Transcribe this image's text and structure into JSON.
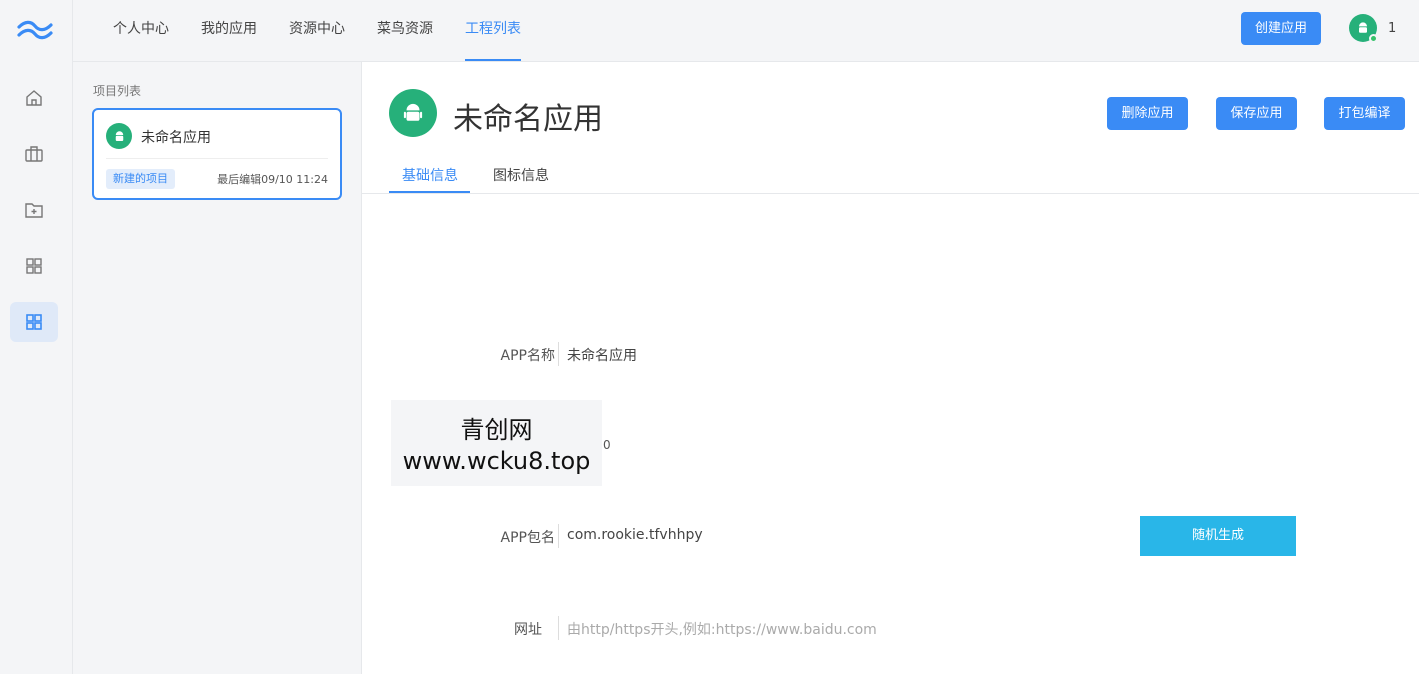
{
  "colors": {
    "accent": "#3a8bf5",
    "android": "#26b07a",
    "generate": "#29b6e8"
  },
  "topnav": {
    "items": [
      "个人中心",
      "我的应用",
      "资源中心",
      "菜鸟资源",
      "工程列表"
    ],
    "active_index": 4,
    "create_label": "创建应用",
    "user_count": "1"
  },
  "rail": {
    "icons": [
      "home-icon",
      "briefcase-icon",
      "folder-add-icon",
      "grid-icon",
      "grid-active-icon"
    ]
  },
  "projects": {
    "section_label": "项目列表",
    "card": {
      "name": "未命名应用",
      "tag": "新建的项目",
      "time": "最后编辑09/10 11:24"
    }
  },
  "main": {
    "title": "未命名应用",
    "buttons": {
      "delete": "删除应用",
      "save": "保存应用",
      "build": "打包编译"
    },
    "tabs": [
      "基础信息",
      "图标信息"
    ],
    "form": {
      "app_name_label": "APP名称",
      "app_name_value": "未命名应用",
      "zero_text": "0",
      "package_label": "APP包名",
      "package_value": "com.rookie.tfvhhpy",
      "generate_label": "随机生成",
      "url_label": "网址",
      "url_placeholder": "由http/https开头,例如:https://www.baidu.com"
    }
  },
  "watermark": {
    "line1": "青创网",
    "line2": "www.wcku8.top"
  }
}
